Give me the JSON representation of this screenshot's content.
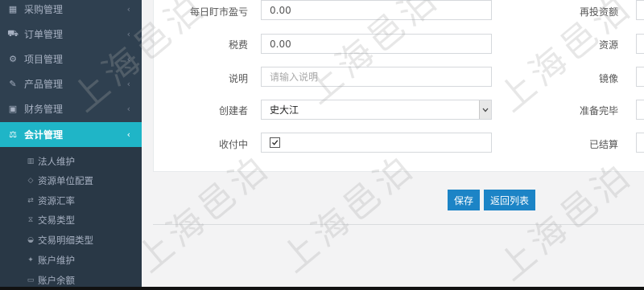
{
  "sidebar": {
    "menu": [
      {
        "label": "采购管理",
        "icon": "grid-icon",
        "glyph": "▦",
        "chevron": "‹"
      },
      {
        "label": "订单管理",
        "icon": "cart-icon",
        "glyph": "⛟",
        "chevron": "‹"
      },
      {
        "label": "项目管理",
        "icon": "cubes-icon",
        "glyph": "⚙",
        "chevron": "‹"
      },
      {
        "label": "产品管理",
        "icon": "edit-icon",
        "glyph": "✎",
        "chevron": "‹"
      },
      {
        "label": "财务管理",
        "icon": "money-icon",
        "glyph": "▣",
        "chevron": "‹"
      },
      {
        "label": "会计管理",
        "icon": "balance-scale-icon",
        "glyph": "⚖",
        "chevron": "‹",
        "active": true
      }
    ],
    "submenu": [
      {
        "label": "法人维护",
        "icon": "bank-icon",
        "glyph": "▥"
      },
      {
        "label": "资源单位配置",
        "icon": "diamond-icon",
        "glyph": "◇"
      },
      {
        "label": "资源汇率",
        "icon": "exchange-icon",
        "glyph": "⇄"
      },
      {
        "label": "交易类型",
        "icon": "hourglass-icon",
        "glyph": "⧖"
      },
      {
        "label": "交易明细类型",
        "icon": "car-icon",
        "glyph": "◒"
      },
      {
        "label": "账户维护",
        "icon": "gavel-icon",
        "glyph": "✦"
      },
      {
        "label": "账户余额",
        "icon": "credit-card-icon",
        "glyph": "▭"
      }
    ]
  },
  "form": {
    "daily_mtm_label": "每日盯市盈亏",
    "daily_mtm_value": "0.00",
    "tax_label": "税费",
    "tax_value": "0.00",
    "desc_label": "说明",
    "desc_placeholder": "请输入说明",
    "creator_label": "创建者",
    "creator_value": "史大江",
    "receiving_label": "收付中",
    "receiving_checked": "☑",
    "reinvest_label": "再投资额",
    "resource_label": "资源",
    "mirror_label": "镜像",
    "ready_label": "准备完毕",
    "settled_label": "已结算"
  },
  "buttons": {
    "save": "保存",
    "back": "返回列表"
  },
  "watermark": "上海邑泊"
}
